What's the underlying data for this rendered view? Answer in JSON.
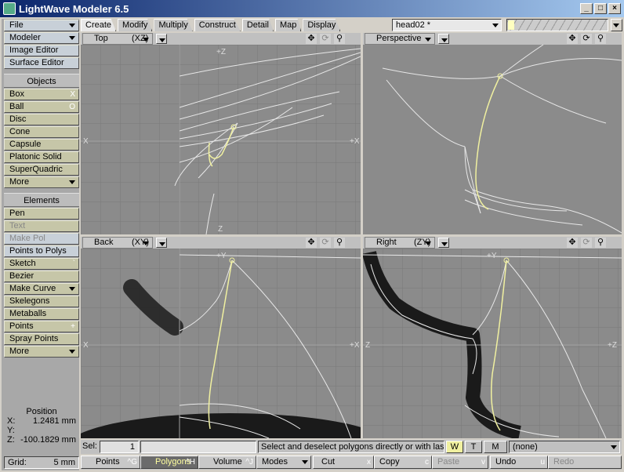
{
  "window": {
    "title": "LightWave Modeler 6.5",
    "min": "_",
    "max": "□",
    "close": "×"
  },
  "sidebar": {
    "file": "File",
    "modeler": "Modeler",
    "image_editor": "Image Editor",
    "surface_editor": "Surface Editor",
    "objects_header": "Objects",
    "objects": [
      {
        "label": "Box",
        "key": "X"
      },
      {
        "label": "Ball",
        "key": "O"
      },
      {
        "label": "Disc",
        "key": ""
      },
      {
        "label": "Cone",
        "key": ""
      },
      {
        "label": "Capsule",
        "key": ""
      },
      {
        "label": "Platonic Solid",
        "key": ""
      },
      {
        "label": "SuperQuadric",
        "key": ""
      },
      {
        "label": "More",
        "key": ""
      }
    ],
    "elements_header": "Elements",
    "elements": [
      {
        "label": "Pen",
        "key": ""
      },
      {
        "label": "Text",
        "key": ""
      },
      {
        "label": "Make Pol",
        "key": ""
      },
      {
        "label": "Points to Polys",
        "key": ""
      },
      {
        "label": "Sketch",
        "key": "`"
      },
      {
        "label": "Bezier",
        "key": ""
      },
      {
        "label": "Make Curve",
        "key": ""
      },
      {
        "label": "Skelegons",
        "key": ""
      },
      {
        "label": "Metaballs",
        "key": ""
      },
      {
        "label": "Points",
        "key": "+"
      },
      {
        "label": "Spray Points",
        "key": ""
      },
      {
        "label": "More",
        "key": ""
      }
    ],
    "position": {
      "title": "Position",
      "x_label": "X:",
      "x_value": "1.2481 mm",
      "y_label": "Y:",
      "y_value": "",
      "z_label": "Z:",
      "z_value": "-100.1829 mm"
    },
    "grid": {
      "label": "Grid:",
      "value": "5 mm"
    }
  },
  "tabs": [
    "Create",
    "Modify",
    "Multiply",
    "Construct",
    "Detail",
    "Map",
    "Display"
  ],
  "active_tab": "Create",
  "object_select": "head02 *",
  "viewports": {
    "top": {
      "name": "Top",
      "axes": "(XZ)",
      "labels": {
        "top": "+Z",
        "left": "X",
        "right": "+X",
        "bottom": "Z"
      }
    },
    "perspective": {
      "name": "Perspective",
      "axes": ""
    },
    "back": {
      "name": "Back",
      "axes": "(XY)",
      "labels": {
        "top": "+Y",
        "left": "X",
        "right": "+X"
      }
    },
    "right": {
      "name": "Right",
      "axes": "(ZY)",
      "labels": {
        "top": "+Y",
        "left": "Z",
        "right": "+Z"
      }
    }
  },
  "status": {
    "sel_label": "Sel:",
    "sel_value": "1",
    "message": "Select and deselect polygons directly or with las...",
    "wtm": [
      "W",
      "T",
      "M"
    ],
    "none": "(none)"
  },
  "bottom": {
    "points": {
      "label": "Points",
      "key": "^G"
    },
    "polygons": {
      "label": "Polygons",
      "key": "^H"
    },
    "volume": {
      "label": "Volume",
      "key": "^J"
    },
    "modes": "Modes",
    "cut": {
      "label": "Cut",
      "key": "x"
    },
    "copy": {
      "label": "Copy",
      "key": "c"
    },
    "paste": {
      "label": "Paste",
      "key": "v"
    },
    "undo": {
      "label": "Undo",
      "key": "u"
    },
    "redo": "Redo"
  },
  "colors": {
    "title_start": "#0a246a",
    "selection": "#f0f0a0",
    "viewport_bg": "#8b8b8b"
  }
}
